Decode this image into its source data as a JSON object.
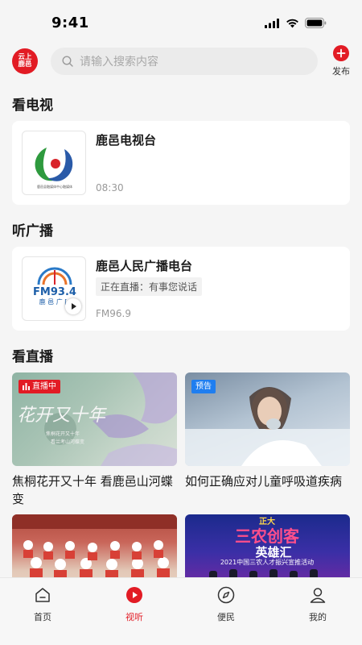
{
  "status": {
    "time": "9:41"
  },
  "header": {
    "logo": [
      "云上",
      "鹿邑"
    ],
    "search_placeholder": "请输入搜索内容",
    "publish_label": "发布"
  },
  "sections": {
    "tv": "看电视",
    "radio": "听广播",
    "live": "看直播"
  },
  "tv_card": {
    "title": "鹿邑电视台",
    "time": "08:30",
    "logo_caption": "鹿邑县融媒体中心融媒体"
  },
  "radio_card": {
    "title": "鹿邑人民广播电台",
    "live_text": "正在直播：有事您说话",
    "frequency": "FM96.9",
    "logo_fm": "FM93.4",
    "logo_sub": "鹿 邑 广 ["
  },
  "videos": [
    {
      "badge": "直播中",
      "title": "焦桐花开又十年 看鹿邑山河蝶变",
      "overlay_big": "花开又十年",
      "overlay_small_1": "焦桐花开又十年",
      "overlay_small_2": "看兰考山河蝶变"
    },
    {
      "badge": "预告",
      "title": "如何正确应对儿童呼吸道疾病"
    },
    {
      "title": ""
    },
    {
      "title": "",
      "overlay_1": "正大",
      "overlay_2": "三农创客",
      "overlay_3": "英雄汇",
      "overlay_4": "2021中国三农人才振兴宣推活动"
    }
  ],
  "tabbar": [
    {
      "label": "首页",
      "icon": "home-icon"
    },
    {
      "label": "视听",
      "icon": "play-icon"
    },
    {
      "label": "便民",
      "icon": "compass-icon"
    },
    {
      "label": "我的",
      "icon": "user-icon"
    }
  ],
  "colors": {
    "brand": "#e21b24",
    "live_badge": "#e21b24",
    "preview_badge": "#1f7ef0"
  }
}
